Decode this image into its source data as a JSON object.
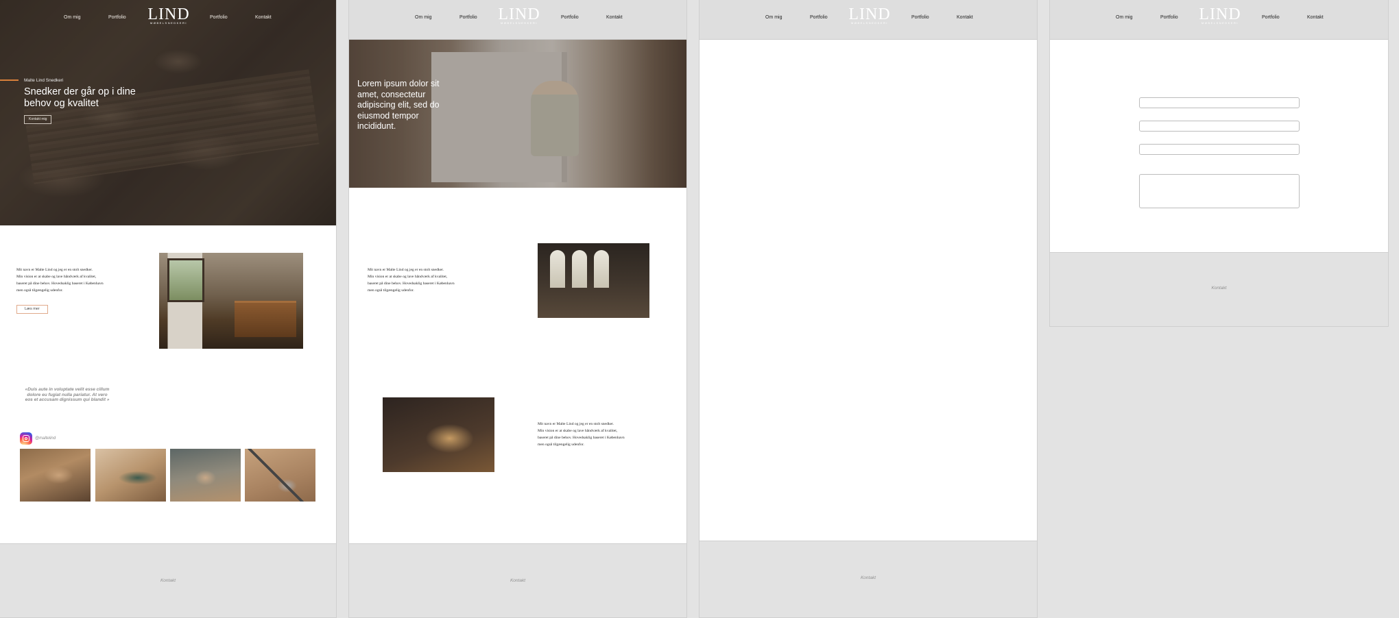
{
  "nav": {
    "about": "Om mig",
    "portfolio_left": "Portfolio",
    "portfolio_right": "Portfolio",
    "contact": "Kontakt",
    "logo_word": "LIND",
    "logo_sub": "MØBELSNEDKERI"
  },
  "home": {
    "hero_eyebrow": "Malte Lind Snedkeri",
    "hero_title": "Snedker der går op i dine behov og kvalitet",
    "hero_button": "Kontakt mig",
    "about_text": "Mit navn er Malte Lind og jeg er en stolt snedker.\nMin vision er at skabe og lave håndværk af kvalitet,\nbaseret på dine behov. Hovedsaklig baseret i København\nmen også tilgængelig udenfor.",
    "read_more": "Læs mer",
    "quote": "«Duis aute in voluptate velit esse cillum\ndolore eu fugiat nulla pariatur. At vero\neos et accusam dignissum qui blandit »",
    "instagram_handle": "@maltelind",
    "footer": "Kontakt"
  },
  "portfolio": {
    "hero_text": "Lorem ipsum dolor sit amet, consectetur adipiscing elit, sed do eiusmod tempor incididunt.",
    "text_1": "Mit navn er Malte Lind og jeg er en stolt snedker.\nMin vision er at skabe og lave håndværk af kvalitet,\nbaseret på dine behov. Hovedsaklig baseret i København\nmen også tilgængelig udenfor.",
    "text_2": "Mit navn er Malte Lind og jeg er en stolt snedker.\nMin vision er at skabe og lave håndværk af kvalitet,\nbaseret på dine behov. Hovedsaklig baseret i København\nmen også tilgængelig udenfor.",
    "footer": "Kontakt"
  },
  "blank": {
    "footer": "Kontakt"
  },
  "contact": {
    "footer": "Kontakt"
  },
  "colors": {
    "accent": "#d9803b",
    "footer_bg": "#e2e2e2",
    "nav_bg": "#dedede"
  }
}
